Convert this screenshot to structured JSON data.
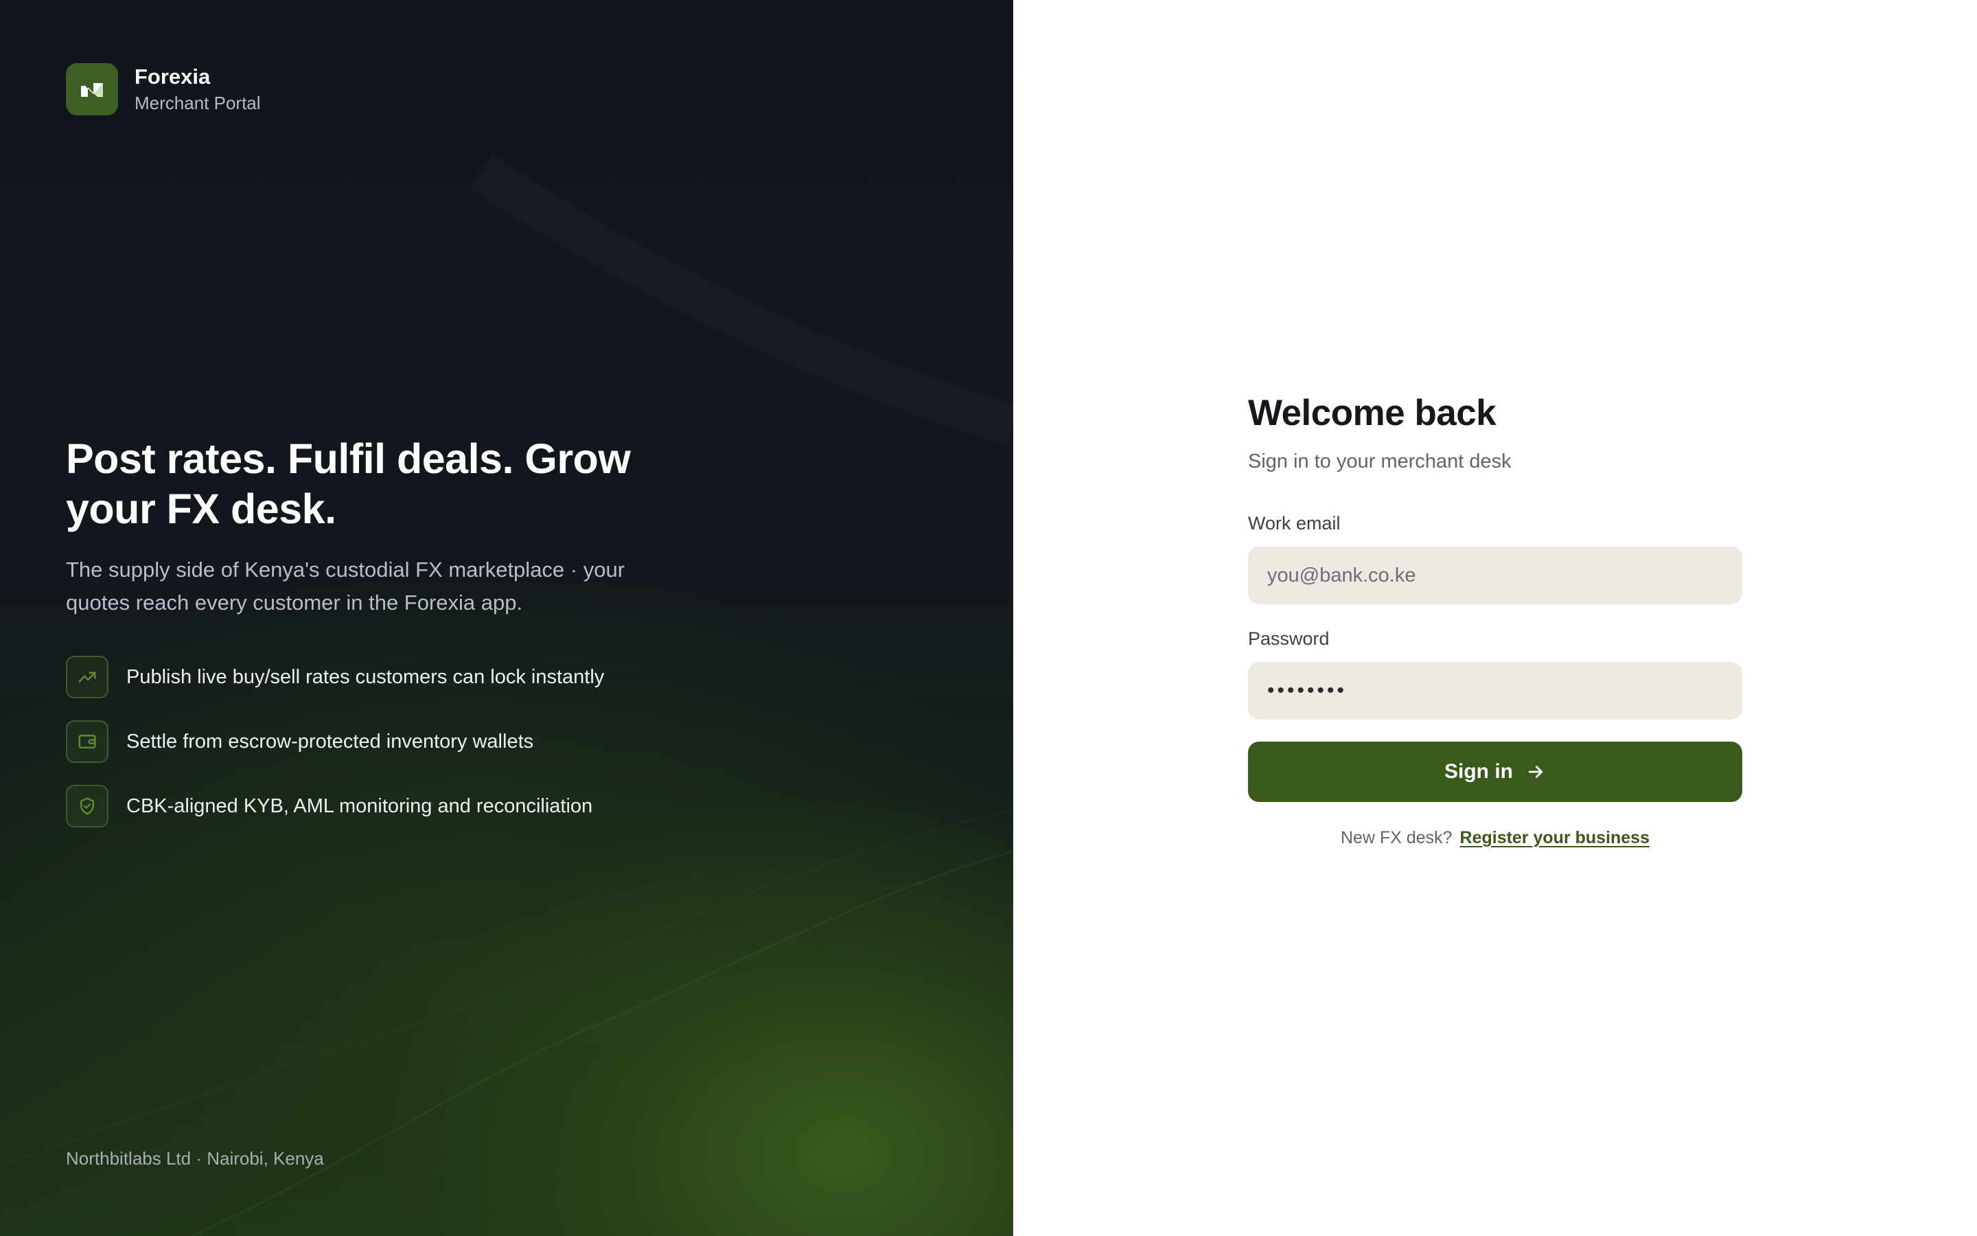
{
  "brand": {
    "name": "Forexia",
    "subtitle": "Merchant Portal",
    "logo_icon": "forexia-logo-icon",
    "accent_color": "#3e5f23"
  },
  "hero": {
    "title": "Post rates. Fulfil deals. Grow your FX desk.",
    "description": "The supply side of Kenya's custodial FX marketplace · your quotes reach every customer in the Forexia app.",
    "features": [
      {
        "icon": "trending-up-icon",
        "label": "Publish live buy/sell rates customers can lock instantly"
      },
      {
        "icon": "wallet-icon",
        "label": "Settle from escrow-protected inventory wallets"
      },
      {
        "icon": "shield-check-icon",
        "label": "CBK-aligned KYB, AML monitoring and reconciliation"
      }
    ]
  },
  "footer": {
    "text": "Northbitlabs Ltd · Nairobi, Kenya"
  },
  "login": {
    "title": "Welcome back",
    "subtitle": "Sign in to your merchant desk",
    "email_label": "Work email",
    "email_placeholder": "you@bank.co.ke",
    "email_value": "",
    "password_label": "Password",
    "password_value": "••••••••",
    "signin_label": "Sign in",
    "signin_icon": "arrow-right-icon",
    "register_prompt": "New FX desk?",
    "register_link": "Register your business",
    "button_color": "#3a5a1c",
    "input_bg_color": "#ede9e2"
  }
}
